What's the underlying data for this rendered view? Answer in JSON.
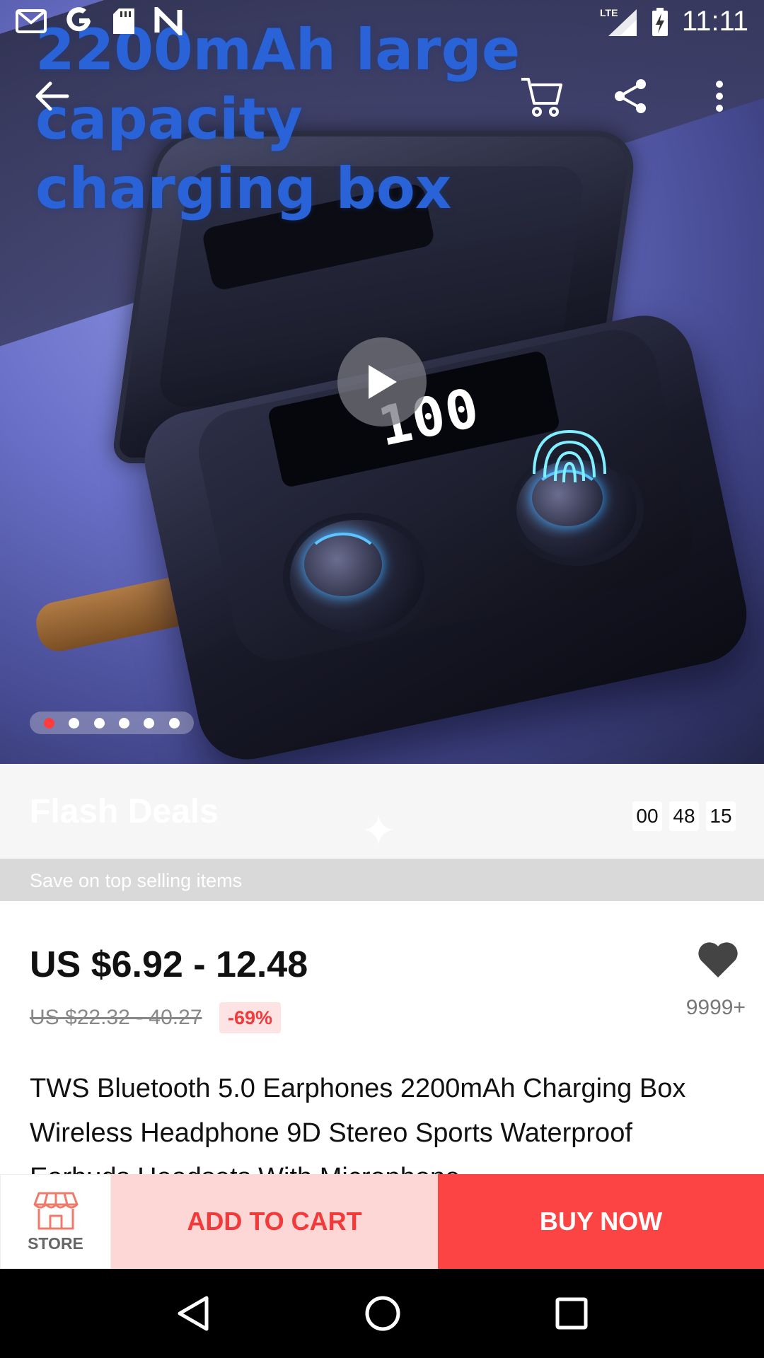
{
  "status_bar": {
    "time": "11:11",
    "network": "LTE",
    "left_icons": [
      "gmail-icon",
      "google-icon",
      "sd-card-icon",
      "n-icon"
    ]
  },
  "hero": {
    "headline_line1": "2200mAh large capacity",
    "headline_line2": "charging box",
    "display_text": "100",
    "carousel_dots": 6,
    "active_dot": 1
  },
  "flash_deals": {
    "title": "Flash Deals",
    "subtitle": "Save on top selling items",
    "countdown": [
      "00",
      "48",
      "15"
    ]
  },
  "product": {
    "price": "US $6.92 - 12.48",
    "original_price": "US $22.32 - 40.27",
    "discount": "-69%",
    "wishlist_count": "9999+",
    "title": "TWS Bluetooth 5.0 Earphones 2200mAh Charging Box Wireless Headphone 9D Stereo Sports Waterproof Earbuds Headsets With Microphone"
  },
  "actions": {
    "store": "STORE",
    "add_to_cart": "ADD TO CART",
    "buy_now": "BUY NOW"
  },
  "colors": {
    "accent": "#fc4444",
    "accent_light": "#fdd6d6",
    "discount_bg": "#fde3e3"
  }
}
